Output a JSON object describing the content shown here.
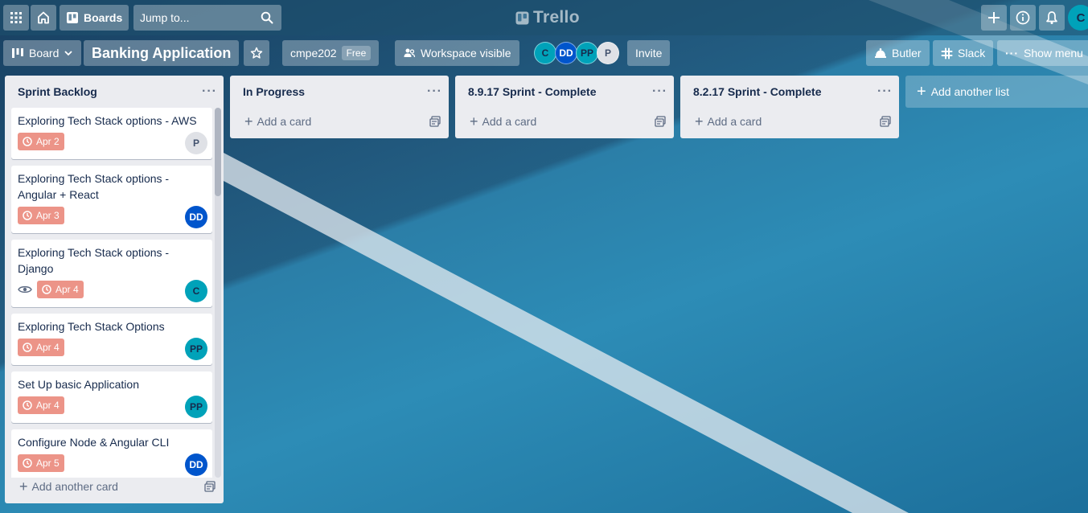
{
  "header": {
    "boards_label": "Boards",
    "jump_placeholder": "Jump to...",
    "logo_text": "Trello",
    "user_initial": "C"
  },
  "board": {
    "view_label": "Board",
    "title": "Banking Application",
    "workspace_name": "cmpe202",
    "workspace_plan": "Free",
    "visibility_label": "Workspace visible",
    "members": [
      {
        "initials": "C",
        "color": "#00a2b9"
      },
      {
        "initials": "DD",
        "color": "#0055cc"
      },
      {
        "initials": "PP",
        "color": "#00a2b9"
      },
      {
        "initials": "P",
        "color": "#dfe1e6"
      }
    ],
    "invite_label": "Invite",
    "butler_label": "Butler",
    "slack_label": "Slack",
    "menu_label": "Show menu"
  },
  "lists": [
    {
      "title": "Sprint Backlog",
      "add_card_label": "Add another card",
      "cards": [
        {
          "title": "Exploring Tech Stack options - AWS",
          "due": "Apr 2",
          "member": "P",
          "member_color": "#dfe1e6",
          "watch": false
        },
        {
          "title": "Exploring Tech Stack options - Angular + React",
          "due": "Apr 3",
          "member": "DD",
          "member_color": "#0055cc",
          "watch": false
        },
        {
          "title": "Exploring Tech Stack options - Django",
          "due": "Apr 4",
          "member": "C",
          "member_color": "#00a2b9",
          "watch": true
        },
        {
          "title": "Exploring Tech Stack Options",
          "due": "Apr 4",
          "member": "PP",
          "member_color": "#00a2b9",
          "watch": false
        },
        {
          "title": "Set Up basic Application",
          "due": "Apr 4",
          "member": "PP",
          "member_color": "#00a2b9",
          "watch": false
        },
        {
          "title": "Configure Node & Angular CLI",
          "due": "Apr 5",
          "member": "DD",
          "member_color": "#0055cc",
          "watch": false
        }
      ]
    },
    {
      "title": "In Progress",
      "add_card_label": "Add a card",
      "cards": []
    },
    {
      "title": "8.9.17 Sprint - Complete",
      "add_card_label": "Add a card",
      "cards": []
    },
    {
      "title": "8.2.17 Sprint - Complete",
      "add_card_label": "Add a card",
      "cards": []
    }
  ],
  "add_list_label": "Add another list",
  "colors": {
    "due_badge": "#ec9488",
    "list_bg": "#ebecf0"
  }
}
